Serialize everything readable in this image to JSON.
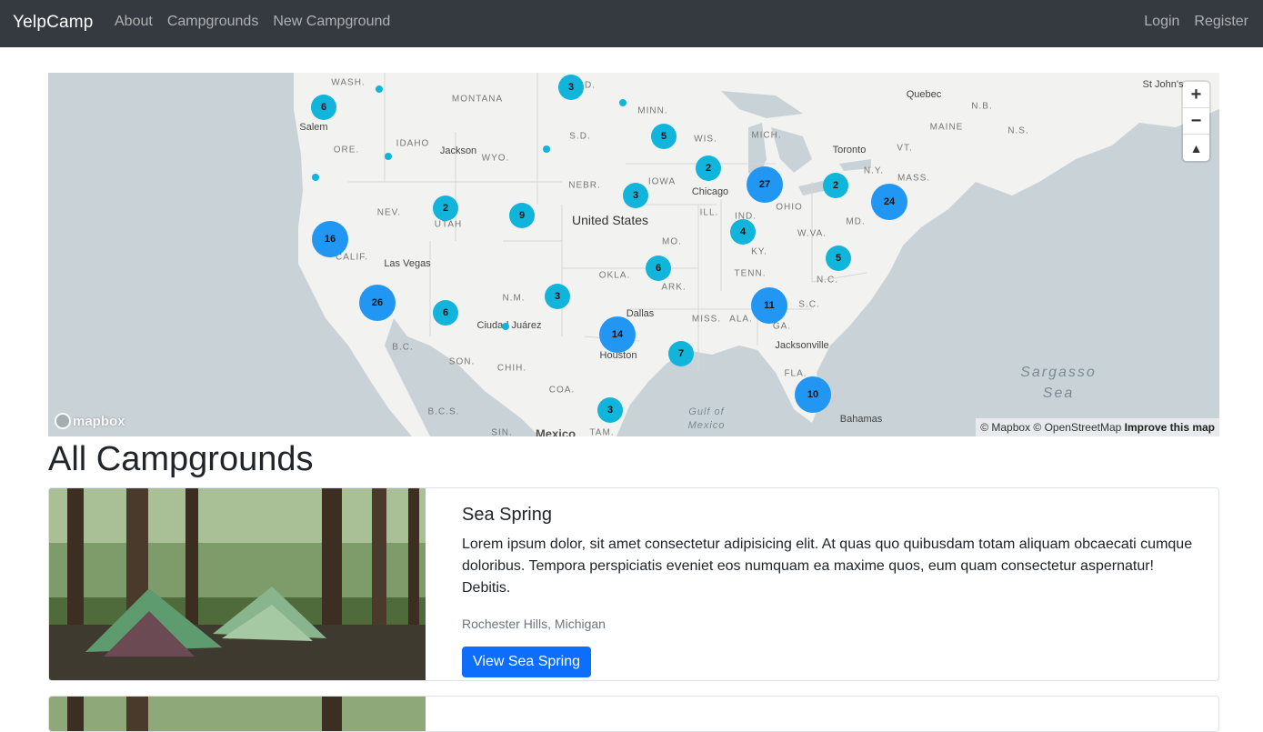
{
  "navbar": {
    "brand": "YelpCamp",
    "links": [
      "About",
      "Campgrounds",
      "New Campground"
    ],
    "right_links": [
      "Login",
      "Register"
    ]
  },
  "map": {
    "attribution": "© Mapbox © OpenStreetMap",
    "improve": "Improve this map",
    "logo": "mapbox",
    "zoom_in": "+",
    "zoom_out": "−",
    "compass": "▲",
    "labels": {
      "country": "United States",
      "sea_1": "Sargasso",
      "sea_2": "Sea",
      "gulf_1": "Gulf of",
      "gulf_2": "Mexico",
      "mexico": "Mexico",
      "cities": [
        "Salem",
        "Jackson",
        "Las Vegas",
        "Ciudad Juárez",
        "Dallas",
        "Houston",
        "Chicago",
        "Toronto",
        "Quebec",
        "Jacksonville",
        "Bahamas",
        "St John's"
      ],
      "states": [
        "WASH.",
        "MONTANA",
        "ORE.",
        "IDAHO",
        "WYO.",
        "NEV.",
        "UTAH",
        "CALIF.",
        "N.M.",
        "N.D.",
        "S.D.",
        "NEBR.",
        "MINN.",
        "WIS.",
        "IOWA",
        "MICH.",
        "ILL.",
        "IND.",
        "OHIO",
        "MO.",
        "KY.",
        "W.VA.",
        "TENN.",
        "OKLA.",
        "ARK.",
        "MISS.",
        "ALA.",
        "GA.",
        "S.C.",
        "N.C.",
        "FLA.",
        "N.Y.",
        "VT.",
        "MASS.",
        "MAINE",
        "MD.",
        "N.B.",
        "N.S.",
        "SON.",
        "CHIH.",
        "COA.",
        "B.C.",
        "B.C.S.",
        "SIN.",
        "TAM."
      ]
    },
    "clusters": [
      {
        "count": "3",
        "size": "small"
      },
      {
        "count": "6",
        "size": "small"
      },
      {
        "count": "5",
        "size": "small"
      },
      {
        "count": "2",
        "size": "small"
      },
      {
        "count": "27",
        "size": "big"
      },
      {
        "count": "2",
        "size": "small"
      },
      {
        "count": "24",
        "size": "big"
      },
      {
        "count": "3",
        "size": "small"
      },
      {
        "count": "2",
        "size": "small"
      },
      {
        "count": "9",
        "size": "small"
      },
      {
        "count": "16",
        "size": "big"
      },
      {
        "count": "4",
        "size": "small"
      },
      {
        "count": "5",
        "size": "small"
      },
      {
        "count": "6",
        "size": "small"
      },
      {
        "count": "3",
        "size": "small"
      },
      {
        "count": "26",
        "size": "big"
      },
      {
        "count": "6",
        "size": "small"
      },
      {
        "count": "11",
        "size": "big"
      },
      {
        "count": "14",
        "size": "big"
      },
      {
        "count": "7",
        "size": "small"
      },
      {
        "count": "10",
        "size": "big"
      },
      {
        "count": "3",
        "size": "small"
      }
    ]
  },
  "page": {
    "heading": "All Campgrounds"
  },
  "campgrounds": [
    {
      "title": "Sea Spring",
      "description": "Lorem ipsum dolor, sit amet consectetur adipisicing elit. At quas quo quibusdam totam aliquam obcaecati cumque doloribus. Tempora perspiciatis eveniet eos numquam ea maxime quos, eum quam consectetur aspernatur! Debitis.",
      "location": "Rochester Hills, Michigan",
      "button": "View Sea Spring"
    }
  ],
  "colors": {
    "navbar": "#343a40",
    "cluster_small": "#11b4da",
    "cluster_big": "#2196f3",
    "primary_button": "#0d6efd"
  }
}
